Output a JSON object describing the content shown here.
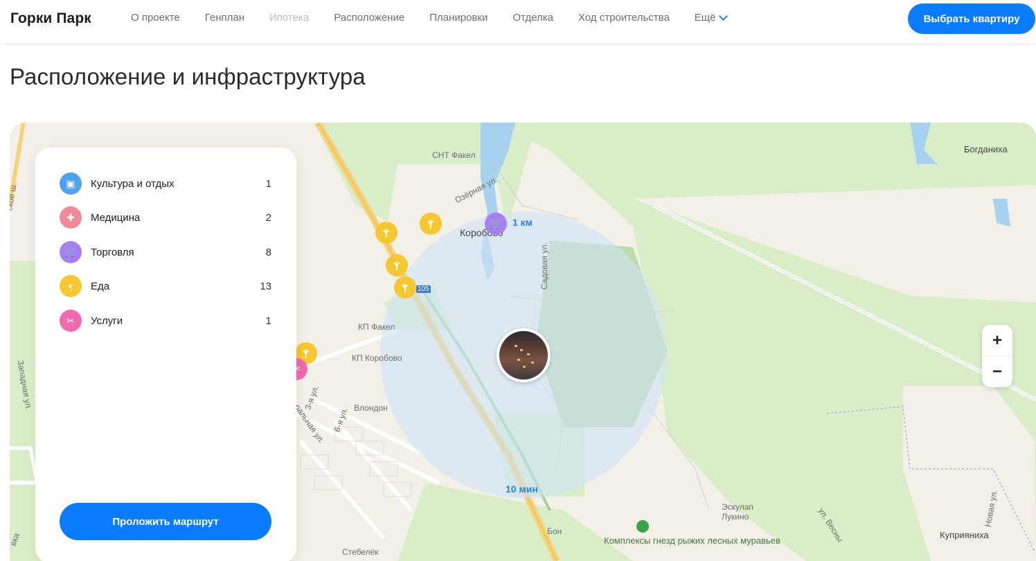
{
  "header": {
    "logo": "Горки Парк",
    "nav": [
      {
        "label": "О проекте"
      },
      {
        "label": "Генплан"
      },
      {
        "label": "Ипотека"
      },
      {
        "label": "Расположение"
      },
      {
        "label": "Планировки"
      },
      {
        "label": "Отделка"
      },
      {
        "label": "Ход строительства"
      }
    ],
    "more_label": "Ещё",
    "cta_label": "Выбрать квартиру"
  },
  "page_title": "Расположение и инфраструктура",
  "panel": {
    "categories": [
      {
        "label": "Культура и отдых",
        "count": "1",
        "color": "#4da3f0",
        "icon": "ticket-icon"
      },
      {
        "label": "Медицина",
        "count": "2",
        "color": "#f08a9a",
        "icon": "medkit-icon"
      },
      {
        "label": "Торговля",
        "count": "8",
        "color": "#a77ff0",
        "icon": "cart-icon"
      },
      {
        "label": "Еда",
        "count": "13",
        "color": "#f5c831",
        "icon": "fork-knife-icon"
      },
      {
        "label": "Услуги",
        "count": "1",
        "color": "#f06ab0",
        "icon": "scissors-icon"
      }
    ],
    "route_label": "Проложить маршрут"
  },
  "map": {
    "labels": {
      "snt_fakel": "СНТ Факел",
      "ozernaya": "Озёрная ул.",
      "korobovo": "Коробово",
      "sadovaya": "Садовая ул.",
      "kp_fakel": "КП Факел",
      "kp_korobovo": "КП Коробово",
      "third_st": "3-я ул.",
      "sixth_st": "6-я ул.",
      "central_st": "ральная ул.",
      "vlondon": "Влондон",
      "zapadnaya": "Западная ул.",
      "bogdanikha": "Богданиха",
      "eskulap": "Эскулап",
      "lukino": "Лукино",
      "vesny": "ул. Весны",
      "novaya": "Новая ул.",
      "kupriyanikha": "Куприяниха",
      "stebelek": "Стебелёк",
      "bon": "Бон",
      "ant_nests": "Комплексы гнезд рыжих лесных муравьев",
      "road_number": "105",
      "sh_label": "ское ш.",
      "vka": "вка"
    },
    "distance_label": "1 км",
    "time_label": "10 мин",
    "zoom_in": "+",
    "zoom_out": "−"
  }
}
